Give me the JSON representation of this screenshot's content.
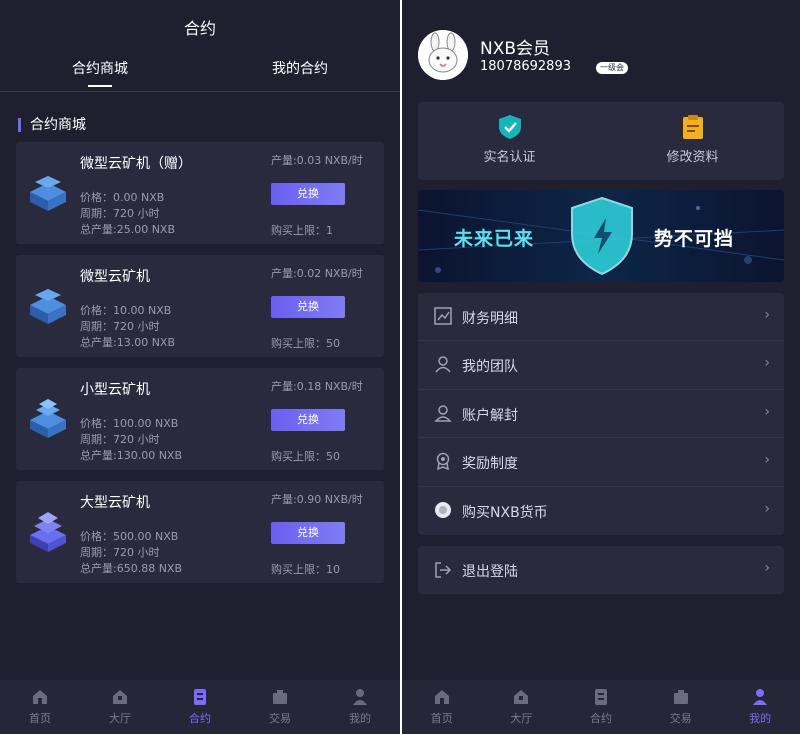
{
  "left": {
    "title": "合约",
    "tabs": [
      {
        "label": "合约商城"
      },
      {
        "label": "我的合约"
      }
    ],
    "section_title": "合约商城",
    "cards": [
      {
        "name": "微型云矿机（赠）",
        "price": "价格：0.00 NXB",
        "period": "周期：720 小时",
        "total": "总产量:25.00 NXB",
        "output": "产量:0.03 NXB/时",
        "button": "兑换",
        "limit": "购买上限：1"
      },
      {
        "name": "微型云矿机",
        "price": "价格：10.00 NXB",
        "period": "周期：720 小时",
        "total": "总产量:13.00 NXB",
        "output": "产量:0.02 NXB/时",
        "button": "兑换",
        "limit": "购买上限：50"
      },
      {
        "name": "小型云矿机",
        "price": "价格：100.00 NXB",
        "period": "周期：720 小时",
        "total": "总产量:130.00 NXB",
        "output": "产量:0.18 NXB/时",
        "button": "兑换",
        "limit": "购买上限：50"
      },
      {
        "name": "大型云矿机",
        "price": "价格：500.00 NXB",
        "period": "周期：720 小时",
        "total": "总产量:650.88 NXB",
        "output": "产量:0.90 NXB/时",
        "button": "兑换",
        "limit": "购买上限：10"
      }
    ],
    "nav": [
      {
        "label": "首页"
      },
      {
        "label": "大厅"
      },
      {
        "label": "合约"
      },
      {
        "label": "交易"
      },
      {
        "label": "我的"
      }
    ]
  },
  "right": {
    "user": {
      "name": "NXB会员",
      "phone": "18078692893",
      "level": "一级会"
    },
    "quick": [
      {
        "label": "实名认证",
        "icon": "shield-check-icon"
      },
      {
        "label": "修改资料",
        "icon": "clipboard-icon"
      }
    ],
    "banner": {
      "left_text": "未来已来",
      "right_text": "势不可挡"
    },
    "menu": [
      {
        "label": "财务明细",
        "icon": "chart-icon"
      },
      {
        "label": "我的团队",
        "icon": "team-icon"
      },
      {
        "label": "账户解封",
        "icon": "user-icon"
      },
      {
        "label": "奖励制度",
        "icon": "award-icon"
      },
      {
        "label": "购买NXB货币",
        "icon": "coin-icon"
      }
    ],
    "logout": {
      "label": "退出登陆",
      "icon": "logout-icon"
    },
    "arrow": "›",
    "nav": [
      {
        "label": "首页"
      },
      {
        "label": "大厅"
      },
      {
        "label": "合约"
      },
      {
        "label": "交易"
      },
      {
        "label": "我的"
      }
    ]
  },
  "colors": {
    "accent": "#7c6cf5",
    "bg": "#1f1f30",
    "card": "#2a2a3f"
  }
}
